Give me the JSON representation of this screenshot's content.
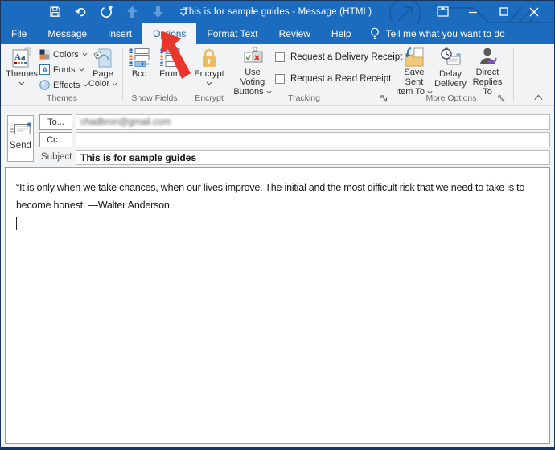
{
  "colors": {
    "titlebar_blue": "#1b6cbe",
    "active_tab_text": "#1f66ad",
    "annotation_arrow_red": "#e8362c",
    "encrypt_lock_gold": "#e9bc62",
    "ribbon_background": "#f2f3f4"
  },
  "window": {
    "title": "This is for sample guides  -  Message (HTML)",
    "controls": [
      "ribbon-display-options",
      "minimize",
      "maximize",
      "close"
    ]
  },
  "quick_access_toolbar": {
    "icons": [
      "save",
      "undo",
      "redo",
      "move-up",
      "move-down",
      "customize-quick-access-toolbar"
    ]
  },
  "tabs": {
    "file": "File",
    "message": "Message",
    "insert": "Insert",
    "options": "Options",
    "format_text": "Format Text",
    "review": "Review",
    "help": "Help",
    "active_tab": "Options",
    "tell_me": "Tell me what you want to do"
  },
  "ribbon": {
    "themes": {
      "group_label": "Themes",
      "themes_button": "Themes",
      "colors_button": "Colors",
      "fonts_button": "Fonts",
      "effects_button": "Effects",
      "page_color_line1": "Page",
      "page_color_line2": "Color"
    },
    "show_fields": {
      "group_label": "Show Fields",
      "bcc_button": "Bcc",
      "from_button": "From"
    },
    "encrypt": {
      "group_label": "Encrypt",
      "encrypt_button": "Encrypt"
    },
    "tracking": {
      "group_label": "Tracking",
      "voting_line1": "Use Voting",
      "voting_line2": "Buttons",
      "delivery_receipt_label": "Request a Delivery Receipt",
      "delivery_receipt_checked": false,
      "read_receipt_label": "Request a Read Receipt",
      "read_receipt_checked": false
    },
    "more_options": {
      "group_label": "More Options",
      "save_sent_line1": "Save Sent",
      "save_sent_line2": "Item To",
      "delay_line1": "Delay",
      "delay_line2": "Delivery",
      "direct_line1": "Direct",
      "direct_line2": "Replies To"
    }
  },
  "fields": {
    "send_button": "Send",
    "to_button": "To...",
    "to_value": "chadbron@gmail.com",
    "to_value_note": "blurred-in-screenshot",
    "cc_button": "Cc...",
    "cc_value": "",
    "subject_label": "Subject",
    "subject_value": "This is for sample guides"
  },
  "message": {
    "body": "“It is only when we take chances, when our lives improve. The initial and the most difficult risk that we need to take is to become honest. —Walter Anderson"
  }
}
